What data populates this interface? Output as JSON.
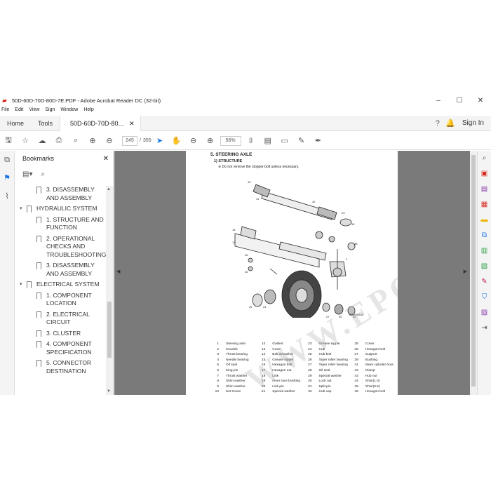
{
  "window": {
    "title": "50D-60D-70D-80D-7E.PDF - Adobe Acrobat Reader DC (32-bit)",
    "controls": [
      "–",
      "☐",
      "✕"
    ]
  },
  "menu": [
    "File",
    "Edit",
    "View",
    "Sign",
    "Window",
    "Help"
  ],
  "tabs": {
    "home": "Home",
    "tools": "Tools",
    "doc": "50D-60D-70D-80...",
    "sign_in": "Sign In"
  },
  "toolbar": {
    "page_current": "245",
    "page_sep": "/",
    "page_total": "355",
    "zoom": "56%"
  },
  "bookmarks": {
    "title": "Bookmarks",
    "items": [
      {
        "level": 2,
        "label": "3. DISASSEMBLY AND ASSEMBLY"
      },
      {
        "level": 1,
        "label": "HYDRAULIC SYSTEM"
      },
      {
        "level": 2,
        "label": "1. STRUCTURE AND FUNCTION"
      },
      {
        "level": 2,
        "label": "2. OPERATIONAL CHECKS AND TROUBLESHOOTING"
      },
      {
        "level": 2,
        "label": "3. DISASSEMBLY AND ASSEMBLY"
      },
      {
        "level": 1,
        "label": "ELECTRICAL SYSTEM"
      },
      {
        "level": 2,
        "label": "1. COMPONENT LOCATION"
      },
      {
        "level": 2,
        "label": "2. ELECTRICAL CIRCUIT"
      },
      {
        "level": 2,
        "label": "3. CLUSTER"
      },
      {
        "level": 2,
        "label": "4. COMPONENT SPECIFICATION"
      },
      {
        "level": 2,
        "label": "5. CONNECTOR DESTINATION"
      }
    ]
  },
  "page": {
    "heading": "5. STEERING AXLE",
    "subheading": "1) STRUCTURE",
    "note": "※ Do not remove the stopper bolt unless necessary.",
    "figure_id": "0809700A3S",
    "watermark": "WWW.EPCATALOG.COM",
    "parts": [
      [
        "1",
        "Steering axle"
      ],
      [
        "12",
        "Gasket"
      ],
      [
        "23",
        "Grease nipple"
      ],
      [
        "35",
        "Cover"
      ],
      [
        "2",
        "Knuckle"
      ],
      [
        "13",
        "Cover"
      ],
      [
        "24",
        "Hub"
      ],
      [
        "36",
        "Hexagon bolt"
      ],
      [
        "3",
        "Thrust bearing"
      ],
      [
        "14",
        "Bolt w/washer"
      ],
      [
        "25",
        "Hub bolt"
      ],
      [
        "37",
        "Support"
      ],
      [
        "4",
        "Needle bearing"
      ],
      [
        "15",
        "Grease nipple"
      ],
      [
        "26",
        "Taper roller bearing"
      ],
      [
        "38",
        "Bushing"
      ],
      [
        "5",
        "Oil seal"
      ],
      [
        "16",
        "Hexagon bolt"
      ],
      [
        "27",
        "Taper roller bearing"
      ],
      [
        "41",
        "Steer cylinder boot"
      ],
      [
        "6",
        "King pin"
      ],
      [
        "17",
        "Hexagon nut"
      ],
      [
        "28",
        "Oil seal"
      ],
      [
        "42",
        "Clamp"
      ],
      [
        "7",
        "Thrust washer"
      ],
      [
        "18",
        "Link"
      ],
      [
        "29",
        "Special washer"
      ],
      [
        "43",
        "Hub nut"
      ],
      [
        "8",
        "Shim washer"
      ],
      [
        "19",
        "Inner race bushing"
      ],
      [
        "30",
        "Lock nut"
      ],
      [
        "44",
        "Shim(1.0)"
      ],
      [
        "9",
        "Shim washer"
      ],
      [
        "20",
        "Link pin"
      ],
      [
        "31",
        "Split pin"
      ],
      [
        "45",
        "Shim(0.5)"
      ],
      [
        "10",
        "Set screw"
      ],
      [
        "21",
        "Special washer"
      ],
      [
        "32",
        "Hub cap"
      ],
      [
        "46",
        "Hexagon bolt"
      ]
    ]
  },
  "colors": {
    "accent": "#1a73e8",
    "doc_background": "#7a7a7a",
    "pdf_red": "#d4261b"
  }
}
